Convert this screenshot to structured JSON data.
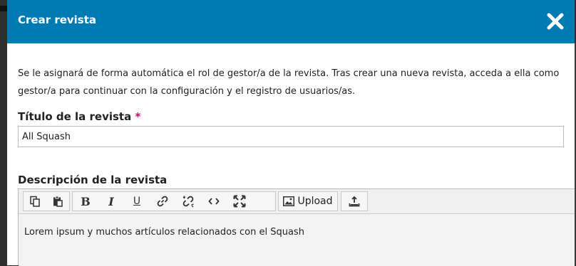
{
  "modal": {
    "title": "Crear revista",
    "intro": "Se le asignará de forma automática el rol de gestor/a de la revista. Tras crear una nueva revista, acceda a ella como gestor/a para continuar con la configuración y el registro de usuarios/as."
  },
  "journal_title": {
    "label": "Título de la revista",
    "required_marker": "*",
    "value": "All Squash"
  },
  "journal_description": {
    "label": "Descripción de la revista",
    "content": "Lorem ipsum y muchos artículos relacionados con el Squash"
  },
  "toolbar": {
    "buttons": [
      {
        "icon": "copy-icon"
      },
      {
        "icon": "paste-icon"
      },
      {
        "icon": "bold-icon",
        "glyph": "B"
      },
      {
        "icon": "italic-icon",
        "glyph": "I"
      },
      {
        "icon": "underline-icon",
        "glyph": "U"
      },
      {
        "icon": "link-icon"
      },
      {
        "icon": "unlink-icon"
      },
      {
        "icon": "code-icon",
        "glyph": "<>"
      },
      {
        "icon": "fullscreen-icon"
      },
      {
        "icon": "image-icon"
      },
      {
        "icon": "upload-file-icon"
      }
    ],
    "upload_label": "Upload"
  },
  "colors": {
    "header": "#007ab2",
    "required": "#d00a6c"
  }
}
